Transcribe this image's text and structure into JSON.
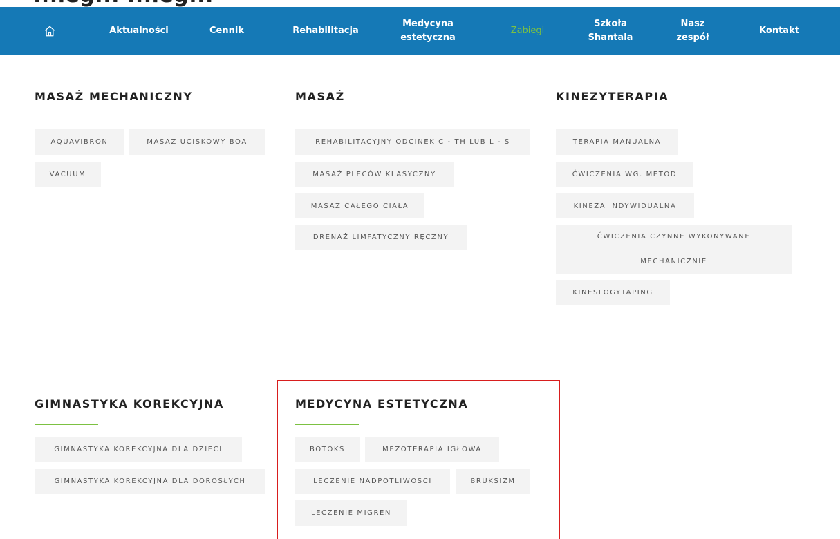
{
  "partial_heading": "...ieg...          ...ieg...",
  "nav": {
    "home_icon": "home-icon",
    "items": [
      {
        "label": "Aktualności",
        "active": false
      },
      {
        "label": "Cennik",
        "active": false
      },
      {
        "label": "Rehabilitacja",
        "active": false
      },
      {
        "label": "Medycyna\nestetyczna",
        "active": false
      },
      {
        "label": "Zabiegi",
        "active": true
      },
      {
        "label": "Szkoła\nShantala",
        "active": false
      },
      {
        "label": "Nasz\nzespół",
        "active": false
      },
      {
        "label": "Kontakt",
        "active": false
      }
    ],
    "bg_color": "#1579b6",
    "active_color": "#7cc142"
  },
  "sections": {
    "masaz_mechaniczny": {
      "title": "MASAŻ MECHANICZNY",
      "tags": [
        "AQUAVIBRON",
        "MASAŻ UCISKOWY BOA",
        "VACUUM"
      ]
    },
    "masaz": {
      "title": "MASAŻ",
      "tags": [
        "REHABILITACYJNY ODCINEK C - TH LUB L - S",
        "MASAŻ PLECÓW KLASYCZNY",
        "MASAŻ CAŁEGO CIAŁA",
        "DRENAŻ LIMFATYCZNY RĘCZNY"
      ]
    },
    "kinezyterapia": {
      "title": "KINEZYTERAPIA",
      "tags": [
        "TERAPIA MANUALNA",
        "ĆWICZENIA WG. METOD",
        "KINEZA INDYWIDUALNA",
        "ĆWICZENIA CZYNNE WYKONYWANE",
        "MECHANICZNIE",
        "KINESLOGYTAPING"
      ]
    },
    "gimnastyka": {
      "title": "GIMNASTYKA KOREKCYJNA",
      "tags": [
        "GIMNASTYKA KOREKCYJNA DLA DZIECI",
        "GIMNASTYKA KOREKCYJNA DLA DOROSŁYCH"
      ]
    },
    "medycyna": {
      "title": "MEDYCYNA ESTETYCZNA",
      "tags": [
        "BOTOKS",
        "MEZOTERAPIA IGŁOWA",
        "LECZENIE NADPOTLIWOŚCI",
        "BRUKSIZM",
        "LECZENIE MIGREN"
      ]
    }
  },
  "accent_line_color": "#7cc142",
  "highlight_color": "#d81e1e"
}
